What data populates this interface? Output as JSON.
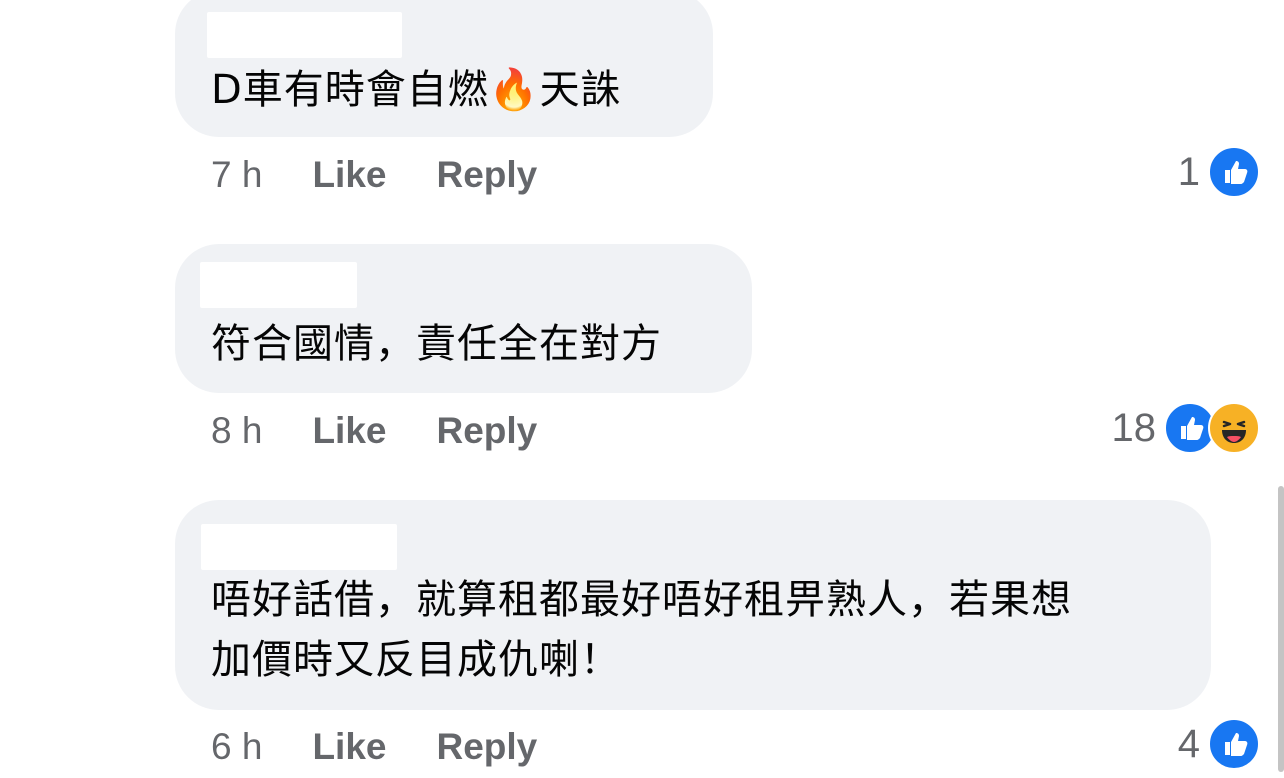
{
  "comments": [
    {
      "text": "D車有時會自燃🔥天誅",
      "time": "7 h",
      "like_label": "Like",
      "reply_label": "Reply",
      "reaction_count": "1",
      "reactions": [
        "like-icon"
      ]
    },
    {
      "text": "符合國情，責任全在對方",
      "time": "8 h",
      "like_label": "Like",
      "reply_label": "Reply",
      "reaction_count": "18",
      "reactions": [
        "like-icon",
        "haha-icon"
      ]
    },
    {
      "text": "唔好話借，就算租都最好唔好租畀熟人，若果想\n加價時又反目成仇喇！",
      "time": "6 h",
      "like_label": "Like",
      "reply_label": "Reply",
      "reaction_count": "4",
      "reactions": [
        "like-icon"
      ]
    }
  ],
  "colors": {
    "bubble": "#f0f2f5",
    "meta_text": "#65676b",
    "like_blue": "#1877f2",
    "haha_yellow": "#f7b125"
  }
}
